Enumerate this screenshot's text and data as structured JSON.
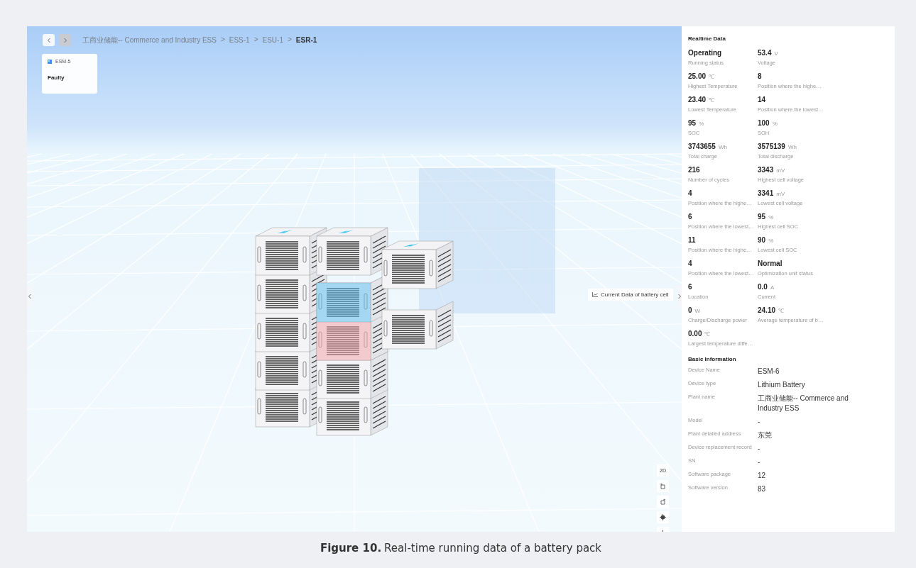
{
  "breadcrumb": [
    {
      "label": "工商业储能-- Commerce and Industry ESS",
      "selected": false
    },
    {
      "label": "ESS-1",
      "selected": false
    },
    {
      "label": "ESU-1",
      "selected": false
    },
    {
      "label": "ESR-1",
      "selected": true
    }
  ],
  "breadcrumb_separator": ">",
  "module_card": {
    "name": "ESM-5",
    "status": "Faulty"
  },
  "cell_data_button": "Current Data of battery cell",
  "view_toolbar": {
    "mode_button": "2D"
  },
  "realtime": {
    "title": "Realtime Data",
    "metrics": [
      {
        "value": "Operating",
        "label": "Running status"
      },
      {
        "value": "53.4",
        "unit": "V",
        "label": "Voltage"
      },
      {
        "value": "25.00",
        "unit": "℃",
        "label": "Highest Temperature"
      },
      {
        "value": "8",
        "label": "Position where the highe…"
      },
      {
        "value": "23.40",
        "unit": "℃",
        "label": "Lowest Temperature"
      },
      {
        "value": "14",
        "label": "Position where the lowest…"
      },
      {
        "value": "95",
        "unit": "%",
        "label": "SOC"
      },
      {
        "value": "100",
        "unit": "%",
        "label": "SOH"
      },
      {
        "value": "3743655",
        "unit": "Wh",
        "label": "Total charge"
      },
      {
        "value": "3575139",
        "unit": "Wh",
        "label": "Total discharge"
      },
      {
        "value": "216",
        "label": "Number of cycles"
      },
      {
        "value": "3343",
        "unit": "mV",
        "label": "Highest cell voltage"
      },
      {
        "value": "4",
        "label": "Position where the highe…"
      },
      {
        "value": "3341",
        "unit": "mV",
        "label": "Lowest cell voltage"
      },
      {
        "value": "6",
        "label": "Position where the lowest…"
      },
      {
        "value": "95",
        "unit": "%",
        "label": "Highest cell SOC"
      },
      {
        "value": "11",
        "label": "Position where the highe…"
      },
      {
        "value": "90",
        "unit": "%",
        "label": "Lowest cell SOC"
      },
      {
        "value": "4",
        "label": "Position where the lowest…"
      },
      {
        "value": "Normal",
        "label": "Optimization unit status"
      },
      {
        "value": "6",
        "label": "Location"
      },
      {
        "value": "0.0",
        "unit": "A",
        "label": "Current"
      },
      {
        "value": "0",
        "unit": "W",
        "label": "Charge/Discharge power"
      },
      {
        "value": "24.10",
        "unit": "℃",
        "label": "Average temperature of b…"
      },
      {
        "value": "0.00",
        "unit": "℃",
        "label": "Largest temperature diffe…"
      }
    ]
  },
  "basic_info": {
    "title": "Basic Information",
    "rows": [
      {
        "label": "Device Name",
        "value": "ESM-6"
      },
      {
        "label": "Device type",
        "value": "Lithium Battery"
      },
      {
        "label": "Plant name",
        "value": "工商业储能-- Commerce and Industry ESS"
      },
      {
        "label": "Model",
        "value": "-"
      },
      {
        "label": "Plant detailed address",
        "value": "东莞"
      },
      {
        "label": "Device replacement record",
        "value": "-"
      },
      {
        "label": "SN",
        "value": "-"
      },
      {
        "label": "Software package",
        "value": "12"
      },
      {
        "label": "Software version",
        "value": "83"
      }
    ]
  },
  "caption": {
    "number": "Figure 10.",
    "text": "Real-time running data of a battery pack"
  }
}
